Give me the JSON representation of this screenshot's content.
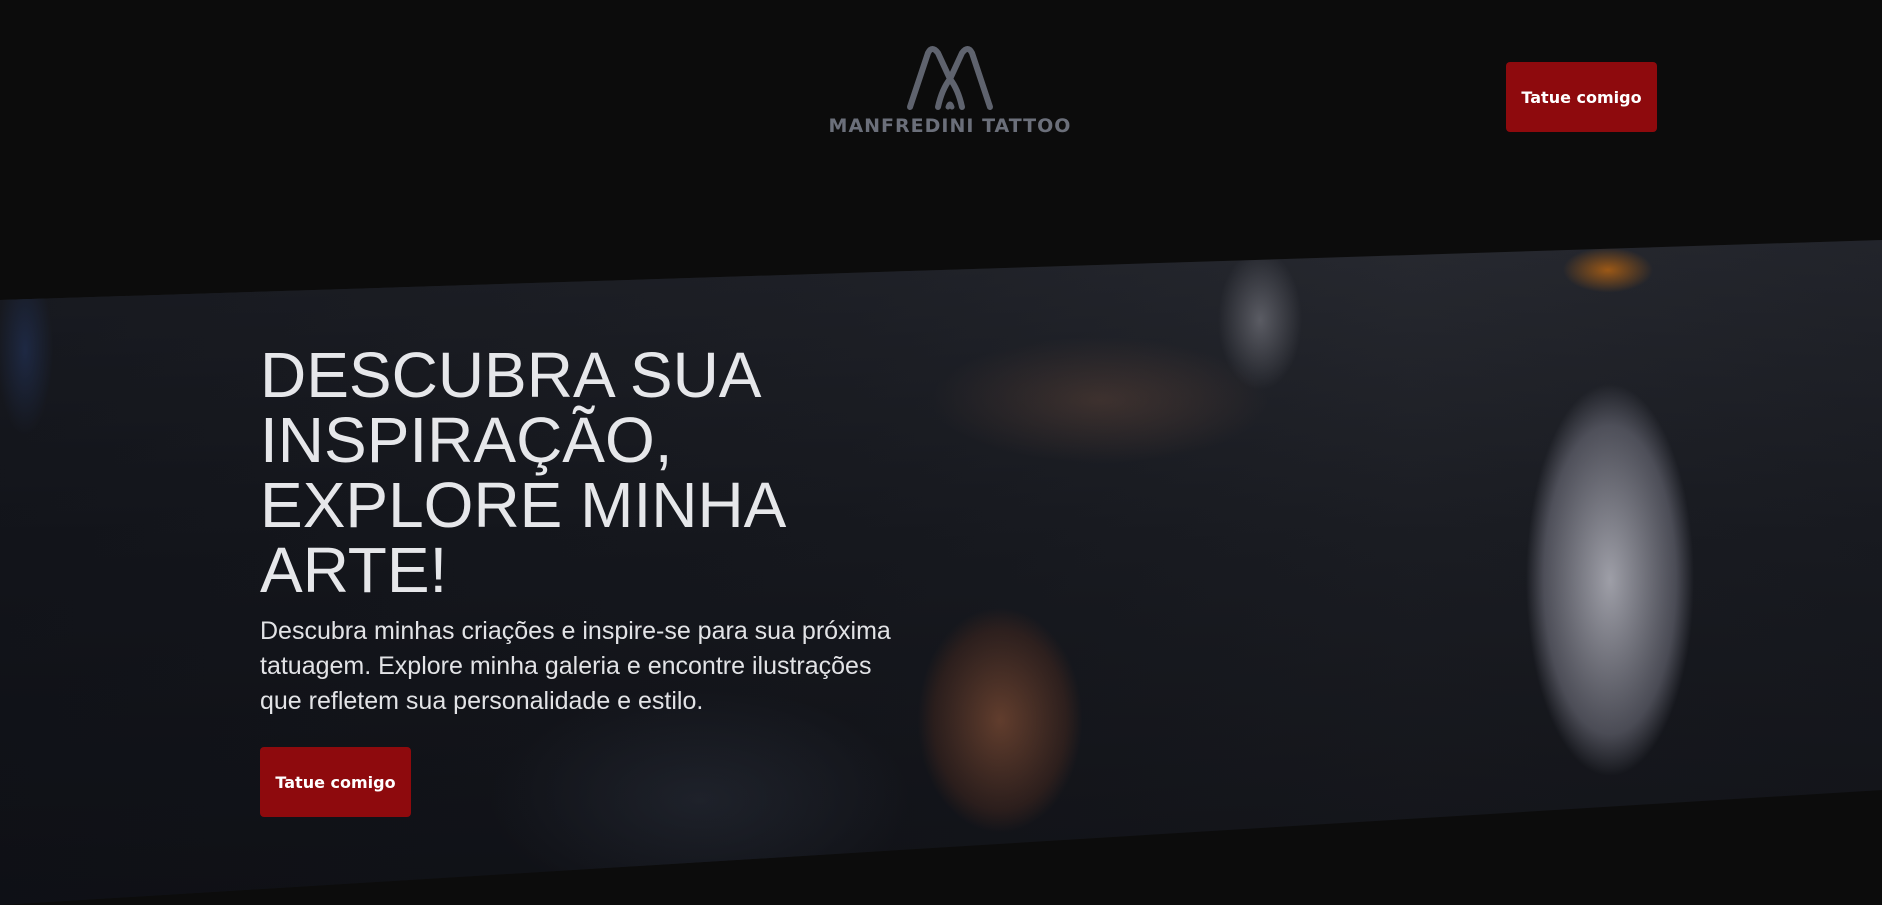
{
  "header": {
    "logo_text": "MANFREDINI TATTOO",
    "cta_label": "Tatue comigo"
  },
  "hero": {
    "title": "DESCUBRA SUA INSPIRAÇÃO, EXPLORE MINHA ARTE!",
    "description": "Descubra minhas criações e inspire-se para sua próxima tatuagem. Explore minha galeria e encontre ilustrações que refletem sua personalidade e estilo.",
    "cta_label": "Tatue comigo"
  },
  "colors": {
    "background": "#0c0c0c",
    "accent": "#8e0a0d",
    "logo": "#6b6f7a",
    "text": "#e6e7ea"
  },
  "icons": {
    "logo_mark": "manfredini-m-logo-icon"
  }
}
